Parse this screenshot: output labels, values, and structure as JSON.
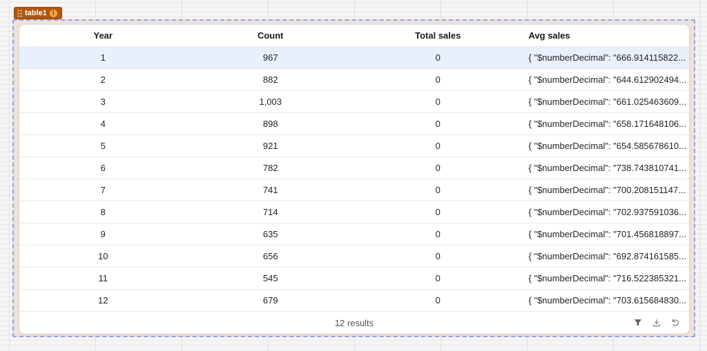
{
  "widget": {
    "badge": {
      "label": "table1",
      "status_icon_glyph": "!"
    },
    "colors": {
      "badge_background": "#b1560f",
      "warning_icon": "#ecab2d",
      "selection_border": "#8fa2f0",
      "selection_fill": "#ede2da",
      "highlighted_row": "#e9effc"
    }
  },
  "table": {
    "columns": [
      {
        "key": "year",
        "label": "Year",
        "align": "center"
      },
      {
        "key": "count",
        "label": "Count",
        "align": "center"
      },
      {
        "key": "total_sales",
        "label": "Total sales",
        "align": "center"
      },
      {
        "key": "avg_sales",
        "label": "Avg sales",
        "align": "left"
      }
    ],
    "highlighted_row_index": 0,
    "rows": [
      {
        "cells": [
          "1",
          "967",
          "0",
          "{ \"$numberDecimal\": \"666.914115822..."
        ]
      },
      {
        "cells": [
          "2",
          "882",
          "0",
          "{ \"$numberDecimal\": \"644.612902494..."
        ]
      },
      {
        "cells": [
          "3",
          "1,003",
          "0",
          "{ \"$numberDecimal\": \"661.025463609..."
        ]
      },
      {
        "cells": [
          "4",
          "898",
          "0",
          "{ \"$numberDecimal\": \"658.171648106..."
        ]
      },
      {
        "cells": [
          "5",
          "921",
          "0",
          "{ \"$numberDecimal\": \"654.585678610..."
        ]
      },
      {
        "cells": [
          "6",
          "782",
          "0",
          "{ \"$numberDecimal\": \"738.743810741..."
        ]
      },
      {
        "cells": [
          "7",
          "741",
          "0",
          "{ \"$numberDecimal\": \"700.208151147..."
        ]
      },
      {
        "cells": [
          "8",
          "714",
          "0",
          "{ \"$numberDecimal\": \"702.937591036..."
        ]
      },
      {
        "cells": [
          "9",
          "635",
          "0",
          "{ \"$numberDecimal\": \"701.456818897..."
        ]
      },
      {
        "cells": [
          "10",
          "656",
          "0",
          "{ \"$numberDecimal\": \"692.874161585..."
        ]
      },
      {
        "cells": [
          "11",
          "545",
          "0",
          "{ \"$numberDecimal\": \"716.522385321..."
        ]
      },
      {
        "cells": [
          "12",
          "679",
          "0",
          "{ \"$numberDecimal\": \"703.615684830..."
        ]
      }
    ]
  },
  "footer": {
    "results_label": "12 results"
  }
}
